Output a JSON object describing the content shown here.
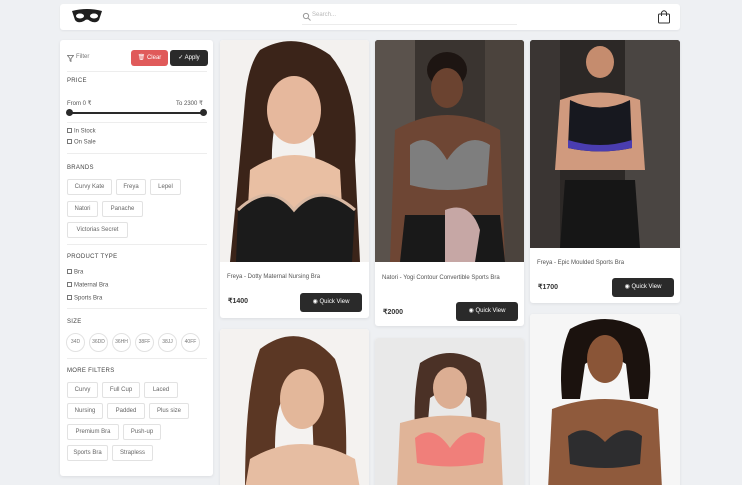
{
  "header": {
    "logo_icon": "mask-logo-icon",
    "search_placeholder": "Search...",
    "bag_icon": "shopping-bag-icon"
  },
  "filter": {
    "label": "Filter",
    "clear_label": "Clear",
    "apply_label": "Apply",
    "price_heading": "PRICE",
    "price_from": "From 0 ₹",
    "price_to": "To 2300 ₹",
    "in_stock": "In Stock",
    "on_sale": "On Sale",
    "brands_heading": "BRANDS",
    "brands": [
      "Curvy Kate",
      "Freya",
      "Lepel",
      "Natori",
      "Panache",
      "Victorias Secret"
    ],
    "product_type_heading": "PRODUCT TYPE",
    "product_types": [
      "Bra",
      "Maternal Bra",
      "Sports Bra"
    ],
    "size_heading": "SIZE",
    "sizes": [
      "34D",
      "36DD",
      "36HH",
      "38FF",
      "38JJ",
      "40FF"
    ],
    "more_heading": "MORE FILTERS",
    "more": [
      "Curvy",
      "Full Cup",
      "Laced",
      "Nursing",
      "Padded",
      "Plus size",
      "Premium Bra",
      "Push-up",
      "Sports Bra",
      "Strapless"
    ]
  },
  "products": [
    {
      "title": "Freya - Dotty Maternal Nursing Bra",
      "price": "₹1400",
      "action": "Quick View"
    },
    {
      "title": "Natori - Yogi Contour Convertible Sports Bra",
      "price": "₹2000",
      "action": "Quick View"
    },
    {
      "title": "Freya - Epic Moulded Sports Bra",
      "price": "₹1700",
      "action": "Quick View"
    }
  ],
  "colors": {
    "clear": "#e05a5a",
    "dark": "#2a2a2a",
    "background": "#eef0f3"
  }
}
